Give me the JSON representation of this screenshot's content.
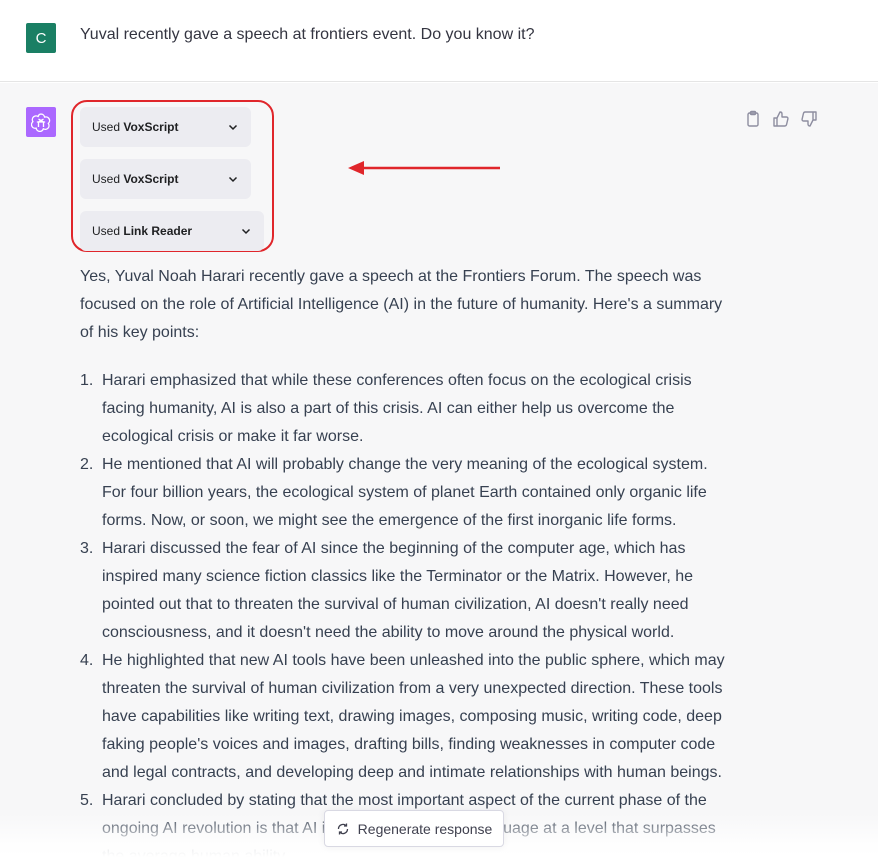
{
  "colors": {
    "user_avatar_bg": "#1a7f64",
    "bot_avatar_bg": "#ab68ff",
    "highlight_red": "#e0262b",
    "assistant_bg": "#f7f7f8"
  },
  "user": {
    "avatar_letter": "C",
    "message": "Yuval recently gave a speech at frontiers event. Do you know it?"
  },
  "assistant": {
    "avatar_icon": "openai-logo-icon",
    "plugins": [
      {
        "prefix": "Used ",
        "name": "VoxScript"
      },
      {
        "prefix": "Used ",
        "name": "VoxScript"
      },
      {
        "prefix": "Used ",
        "name": "Link Reader"
      }
    ],
    "actions": [
      "copy-icon",
      "thumbs-up-icon",
      "thumbs-down-icon"
    ],
    "intro": "Yes, Yuval Noah Harari recently gave a speech at the Frontiers Forum. The speech was focused on the role of Artificial Intelligence (AI) in the future of humanity. Here's a summary of his key points:",
    "points": [
      {
        "num": "1.",
        "text": "Harari emphasized that while these conferences often focus on the ecological crisis facing humanity, AI is also a part of this crisis. AI can either help us overcome the ecological crisis or make it far worse."
      },
      {
        "num": "2.",
        "text": "He mentioned that AI will probably change the very meaning of the ecological system. For four billion years, the ecological system of planet Earth contained only organic life forms. Now, or soon, we might see the emergence of the first inorganic life forms."
      },
      {
        "num": "3.",
        "text": "Harari discussed the fear of AI since the beginning of the computer age, which has inspired many science fiction classics like the Terminator or the Matrix. However, he pointed out that to threaten the survival of human civilization, AI doesn't really need consciousness, and it doesn't need the ability to move around the physical world."
      },
      {
        "num": "4.",
        "text": "He highlighted that new AI tools have been unleashed into the public sphere, which may threaten the survival of human civilization from a very unexpected direction. These tools have capabilities like writing text, drawing images, composing music, writing code, deep faking people's voices and images, drafting bills, finding weaknesses in computer code and legal contracts, and developing deep and intimate relationships with human beings."
      },
      {
        "num": "5.",
        "text": "Harari concluded by stating that the most important aspect of the current phase of the ongoing AI revolution is that AI is gaining mastery of language at a level that surpasses the average human ability."
      }
    ]
  },
  "regenerate": {
    "label": "Regenerate response",
    "icon": "refresh-icon"
  }
}
